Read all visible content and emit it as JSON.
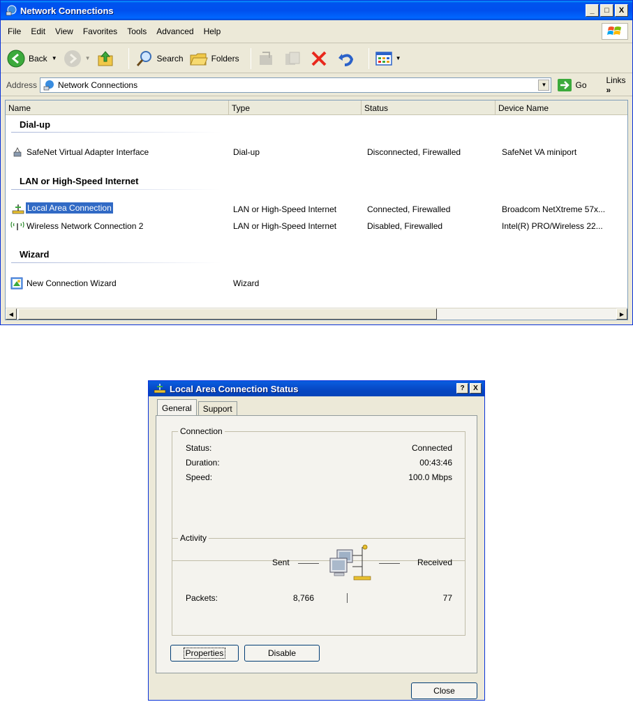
{
  "window": {
    "title": "Network Connections",
    "min_label": "_",
    "max_label": "□",
    "close_label": "X"
  },
  "menu": [
    "File",
    "Edit",
    "View",
    "Favorites",
    "Tools",
    "Advanced",
    "Help"
  ],
  "toolbar": {
    "back": "Back",
    "search": "Search",
    "folders": "Folders"
  },
  "address": {
    "label": "Address",
    "value": "Network Connections",
    "go": "Go",
    "links": "Links"
  },
  "columns": [
    "Name",
    "Type",
    "Status",
    "Device Name"
  ],
  "groups": [
    {
      "title": "Dial-up",
      "rows": [
        {
          "name": "SafeNet Virtual Adapter Interface",
          "type": "Dial-up",
          "status": "Disconnected, Firewalled",
          "device": "SafeNet VA miniport"
        }
      ]
    },
    {
      "title": "LAN or High-Speed Internet",
      "rows": [
        {
          "name": "Local Area Connection",
          "type": "LAN or High-Speed Internet",
          "status": "Connected, Firewalled",
          "device": "Broadcom NetXtreme 57x..."
        },
        {
          "name": "Wireless Network Connection 2",
          "type": "LAN or High-Speed Internet",
          "status": "Disabled, Firewalled",
          "device": "Intel(R) PRO/Wireless 22..."
        }
      ]
    },
    {
      "title": "Wizard",
      "rows": [
        {
          "name": "New Connection Wizard",
          "type": "Wizard",
          "status": "",
          "device": ""
        }
      ]
    }
  ],
  "dialog": {
    "title": "Local Area Connection Status",
    "help_label": "?",
    "close_label": "X",
    "tabs": [
      "General",
      "Support"
    ],
    "connection": {
      "legend": "Connection",
      "status_label": "Status:",
      "status_value": "Connected",
      "duration_label": "Duration:",
      "duration_value": "00:43:46",
      "speed_label": "Speed:",
      "speed_value": "100.0 Mbps"
    },
    "activity": {
      "legend": "Activity",
      "sent_label": "Sent",
      "received_label": "Received",
      "packets_label": "Packets:",
      "sent_value": "8,766",
      "received_value": "77"
    },
    "properties_button": "Properties",
    "disable_button": "Disable",
    "close_button": "Close"
  },
  "colors": {
    "titlebar": "#0054e3",
    "selection": "#316ac5",
    "window_bg": "#ece9d8"
  }
}
